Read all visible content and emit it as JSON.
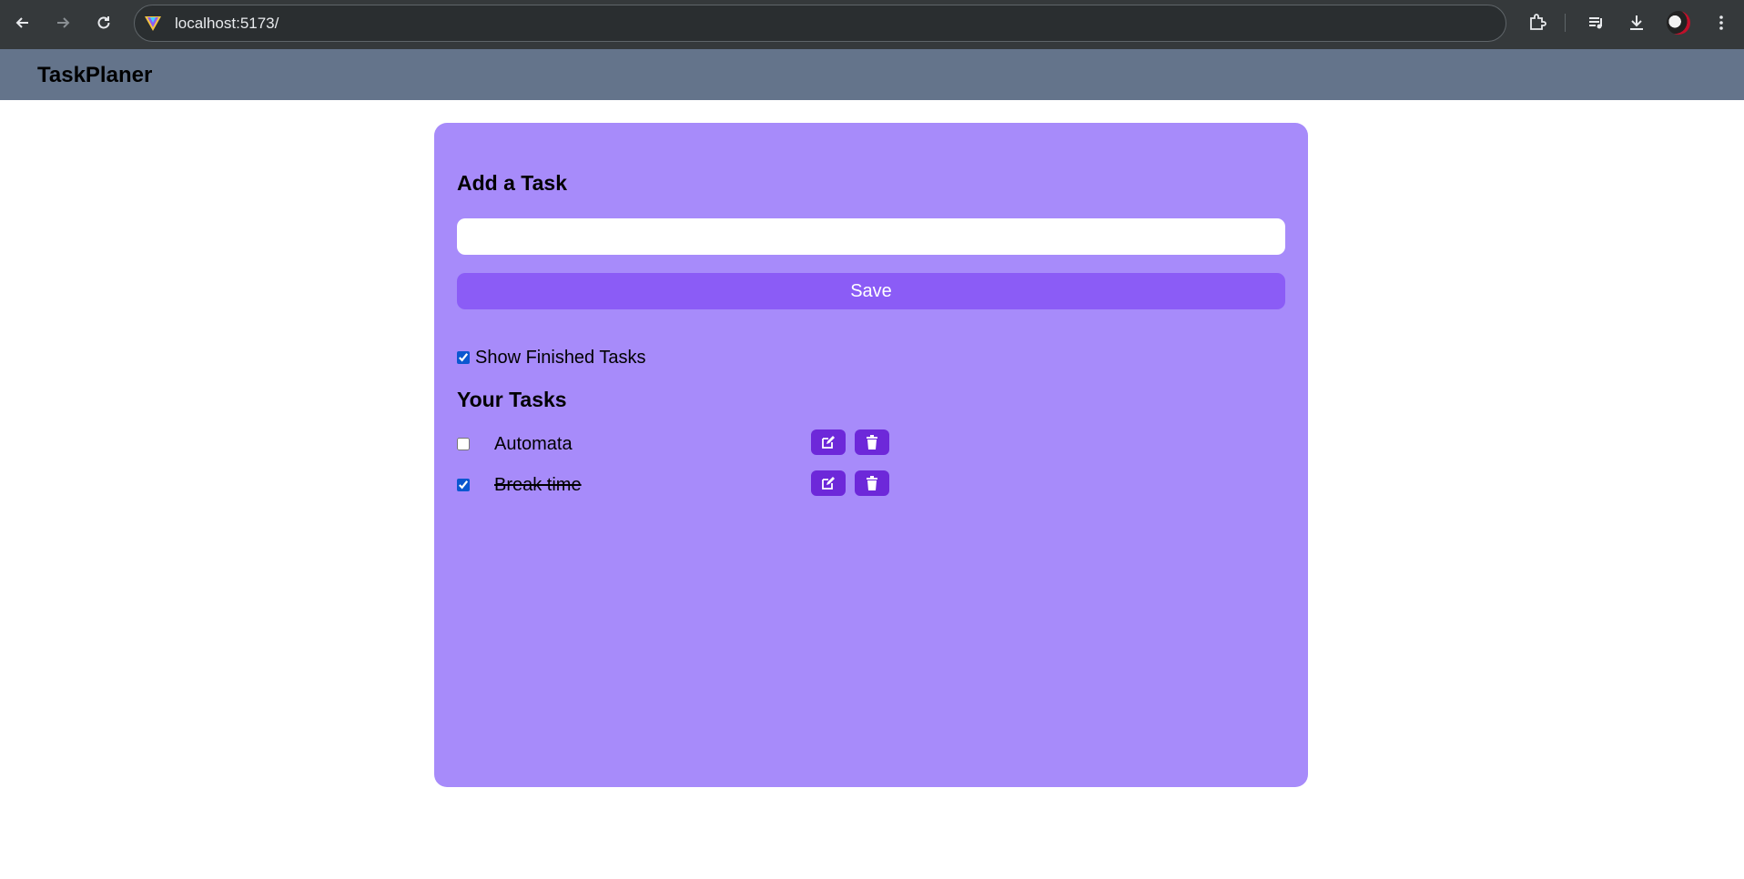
{
  "browser": {
    "url": "localhost:5173/",
    "back_icon": "arrow-left-icon",
    "forward_icon": "arrow-right-icon",
    "reload_icon": "reload-icon",
    "extensions_icon": "puzzle-icon",
    "media_icon": "media-queue-icon",
    "download_icon": "download-icon",
    "menu_icon": "kebab-menu-icon"
  },
  "navbar": {
    "brand": "TaskPlaner",
    "color": "#64748b"
  },
  "add_task": {
    "heading": "Add a Task",
    "input_value": "",
    "save_label": "Save"
  },
  "filter": {
    "show_finished_label": "Show Finished Tasks",
    "show_finished_checked": true
  },
  "tasks": {
    "heading": "Your Tasks",
    "items": [
      {
        "text": "Automata",
        "completed": false
      },
      {
        "text": "Break time",
        "completed": true
      }
    ]
  },
  "colors": {
    "card": "#a78bfa",
    "save_button": "#8b5cf6",
    "icon_button": "#6d28d9"
  }
}
